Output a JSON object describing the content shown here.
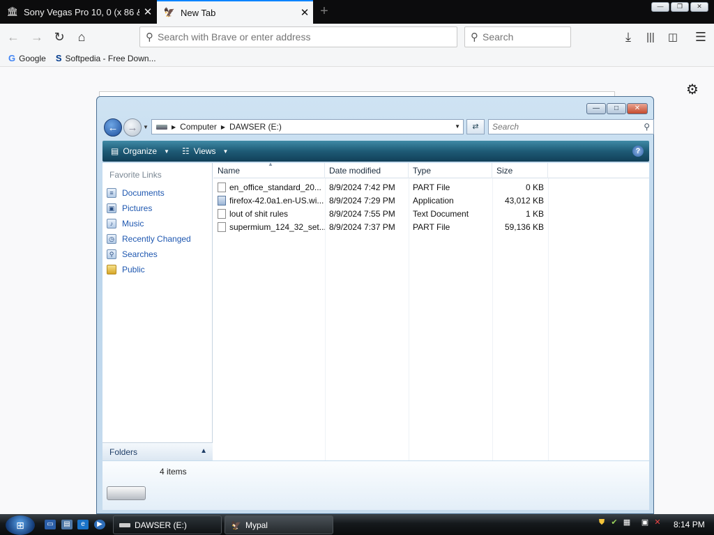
{
  "browser": {
    "tabs": [
      {
        "title": "Sony Vegas Pro 10, 0 (x 86 & X",
        "favicon": "building-icon"
      },
      {
        "title": "New Tab",
        "favicon": "mypal-icon"
      }
    ],
    "url_placeholder": "Search with Brave or enter address",
    "search_placeholder": "Search",
    "bookmarks": [
      {
        "label": "Google",
        "icon": "google-icon"
      },
      {
        "label": "Softpedia - Free Down...",
        "icon": "softpedia-icon"
      }
    ]
  },
  "explorer": {
    "breadcrumb": [
      "Computer",
      "DAWSER (E:)"
    ],
    "search_placeholder": "Search",
    "toolbar": {
      "organize": "Organize",
      "views": "Views"
    },
    "favorite_links_title": "Favorite Links",
    "favorite_links": [
      "Documents",
      "Pictures",
      "Music",
      "Recently Changed",
      "Searches",
      "Public"
    ],
    "folders_label": "Folders",
    "columns": [
      "Name",
      "Date modified",
      "Type",
      "Size"
    ],
    "files": [
      {
        "name": "en_office_standard_20...",
        "date": "8/9/2024 7:42 PM",
        "type": "PART File",
        "size": "0 KB"
      },
      {
        "name": "firefox-42.0a1.en-US.wi...",
        "date": "8/9/2024 7:29 PM",
        "type": "Application",
        "size": "43,012 KB"
      },
      {
        "name": "lout of shit rules",
        "date": "8/9/2024 7:55 PM",
        "type": "Text Document",
        "size": "1 KB"
      },
      {
        "name": "supermium_124_32_set...",
        "date": "8/9/2024 7:37 PM",
        "type": "PART File",
        "size": "59,136 KB"
      }
    ],
    "status": "4 items"
  },
  "taskbar": {
    "buttons": [
      {
        "label": "DAWSER (E:)"
      },
      {
        "label": "Mypal"
      }
    ],
    "clock": "8:14 PM"
  },
  "colors": {
    "accent": "#0a84ff",
    "toolbar": "#1e5b76",
    "link": "#1e57b0"
  }
}
